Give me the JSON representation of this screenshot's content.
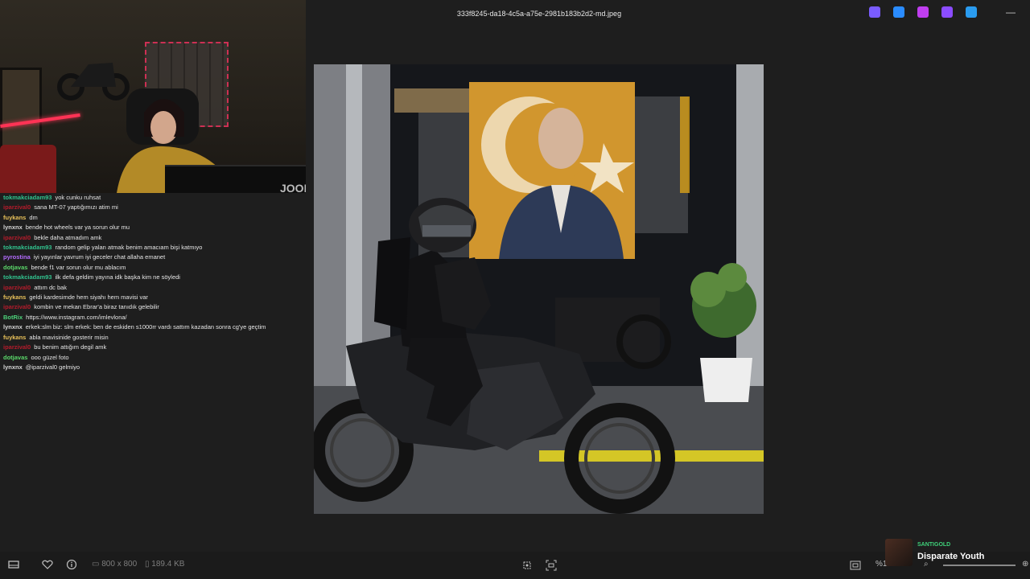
{
  "window": {
    "filename": "333f8245-da18-4c5a-a75e-2981b183b2d2-md.jpeg"
  },
  "top_icons": [
    {
      "name": "copilot-icon",
      "color": "#7a5cff"
    },
    {
      "name": "edit-icon",
      "color": "#2a8cff"
    },
    {
      "name": "designer-icon",
      "color": "#c03ef0"
    },
    {
      "name": "clipchamp-icon",
      "color": "#8b4cff"
    },
    {
      "name": "onedrive-icon",
      "color": "#2a9cf0"
    }
  ],
  "chat": [
    {
      "user": "tokmakciadam93",
      "color": "#31c28e",
      "text": "yok cunku ruhsat"
    },
    {
      "user": "iparzival0",
      "color": "#b51b2b",
      "text": "sana MT-07 yaptığımızı atim mi"
    },
    {
      "user": "fuykans",
      "color": "#e8c15a",
      "text": "dm"
    },
    {
      "user": "lynxnx",
      "color": "#d8d8d8",
      "text": "bende hot wheels var ya sorun olur mu"
    },
    {
      "user": "iparzival0",
      "color": "#b51b2b",
      "text": "bekle daha atmadım amk"
    },
    {
      "user": "tokmakciadam93",
      "color": "#31c28e",
      "text": "random gelip yalan atmak benim amacıam bişi katmıyo"
    },
    {
      "user": "pyrostina",
      "color": "#b46cff",
      "text": "iyi yayınlar yavrum iyi geceler chat allaha emanet"
    },
    {
      "user": "dotjavas",
      "color": "#5bd86a",
      "text": "bende f1 var sorun olur mu ablacım"
    },
    {
      "user": "tokmakciadam93",
      "color": "#31c28e",
      "text": "ilk defa geldim yayına idk başka kim ne söyledi"
    },
    {
      "user": "iparzival0",
      "color": "#b51b2b",
      "text": "attım dc bak"
    },
    {
      "user": "fuykans",
      "color": "#e8c15a",
      "text": "geldi kardesimde hem siyahı hem mavisi var"
    },
    {
      "user": "iparzival0",
      "color": "#b51b2b",
      "text": "kombin ve mekan Ebrar'a biraz tanıdık gelebilir"
    },
    {
      "user": "BotRix",
      "color": "#4cd37a",
      "text": "https://www.instagram.com/imlevlona/"
    },
    {
      "user": "lynxnx",
      "color": "#d8d8d8",
      "text": "erkek:slm biz: slm erkek: ben de eskiden s1000rr vardı sattım kazadan sonra cg'ye geçtim"
    },
    {
      "user": "fuykans",
      "color": "#e8c15a",
      "text": "abla mavisinide gosterir misin"
    },
    {
      "user": "iparzival0",
      "color": "#b51b2b",
      "text": "bu benim attığım degil amk"
    },
    {
      "user": "dotjavas",
      "color": "#5bd86a",
      "text": "ooo güzel foto"
    },
    {
      "user": "lynxnx",
      "color": "#d8d8d8",
      "text": "@iparzival0 gelmiyo"
    }
  ],
  "bottom": {
    "dimensions": "800 x 800",
    "filesize": "189.4 KB",
    "zoom": "%100"
  },
  "now_playing": {
    "artist": "SANTIGOLD",
    "title": "Disparate Youth"
  },
  "webcam": {
    "logo_text": "JOOI"
  }
}
